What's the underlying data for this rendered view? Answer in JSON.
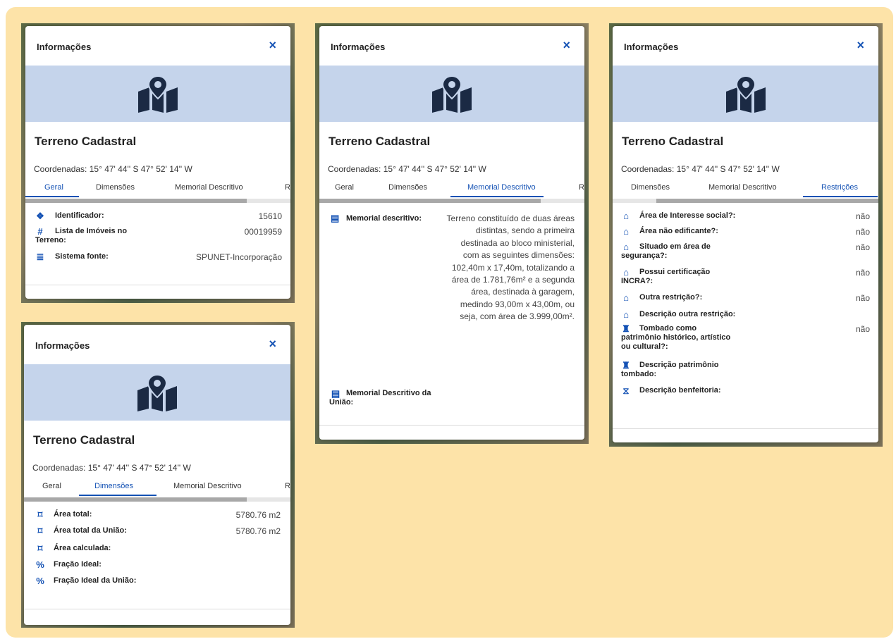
{
  "panel": {
    "title": "Informações",
    "close": "×",
    "name": "Terreno Cadastral",
    "coords": "Coordenadas: 15° 47' 44'' S 47° 52' 14'' W"
  },
  "tabs_a": [
    "Geral",
    "Dimensões",
    "Memorial Descritivo",
    "R"
  ],
  "tabs_c": [
    "Dimensões",
    "Memorial Descritivo",
    "Restrições"
  ],
  "geral": [
    {
      "label": "Identificador:",
      "value": "15610",
      "icon": "id-icon"
    },
    {
      "label": "Lista de Imóveis no Terreno:",
      "value": "00019959",
      "icon": "hash-icon"
    },
    {
      "label": "Sistema fonte:",
      "value": "SPUNET-Incorporação",
      "icon": "database-icon"
    }
  ],
  "dimensoes": [
    {
      "label": "Área total:",
      "value": "5780.76 m2",
      "icon": "area-icon"
    },
    {
      "label": "Área total da União:",
      "value": "5780.76 m2",
      "icon": "area-icon"
    },
    {
      "label": "Área calculada:",
      "value": "",
      "icon": "area-icon"
    },
    {
      "label": "Fração Ideal:",
      "value": "",
      "icon": "percent-icon"
    },
    {
      "label": "Fração Ideal da União:",
      "value": "",
      "icon": "percent-icon"
    }
  ],
  "memorial": {
    "label1": "Memorial descritivo:",
    "text": "Terreno constituído de duas áreas distintas, sendo a primeira destinada ao bloco ministerial, com as seguintes dimensões: 102,40m x 17,40m, totalizando a área de 1.781,76m² e a segunda área, destinada à garagem, medindo 93,00m x 43,00m, ou seja, com área de 3.999,00m².",
    "label2": "Memorial Descritivo da União:"
  },
  "restricoes": [
    {
      "label": "Área de Interesse social?:",
      "value": "não",
      "icon": "house-icon"
    },
    {
      "label": "Área não edificante?:",
      "value": "não",
      "icon": "house-block-icon"
    },
    {
      "label": "Situado em área de segurança?:",
      "value": "não",
      "icon": "house-lock-icon"
    },
    {
      "label": "Possui certificação INCRA?:",
      "value": "não",
      "icon": "house-cert-icon"
    },
    {
      "label": "Outra restrição?:",
      "value": "não",
      "icon": "house-user-icon"
    },
    {
      "label": "Descrição outra restrição:",
      "value": "",
      "icon": "house-user-icon"
    },
    {
      "label": "Tombado como patrimônio histórico, artístico ou cultural?:",
      "value": "não",
      "icon": "monument-icon"
    },
    {
      "label": "Descrição patrimônio tombado:",
      "value": "",
      "icon": "monument-icon"
    },
    {
      "label": "Descrição benfeitoria:",
      "value": "",
      "icon": "hourglass-icon"
    }
  ],
  "colors": {
    "accent": "#1351b4",
    "banner": "#c5d4eb",
    "board": "#fde3a8",
    "icon_dark": "#1b2a44"
  }
}
